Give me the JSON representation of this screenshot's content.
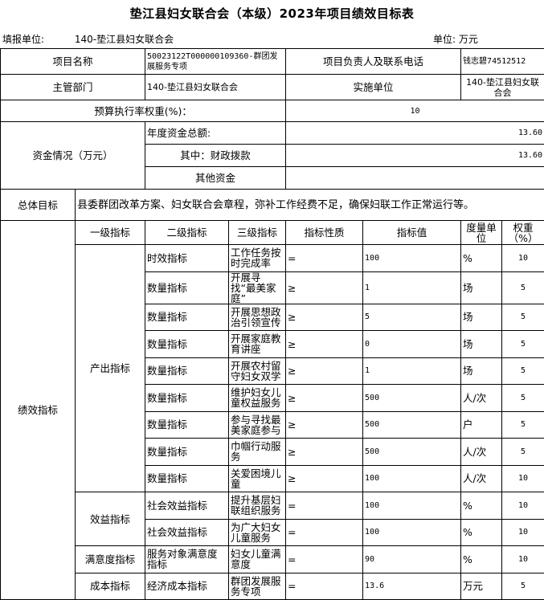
{
  "title": "垫江县妇女联合会（本级）2023年项目绩效目标表",
  "header": {
    "filler_label": "填报单位:",
    "filler_value": "140-垫江县妇女联合会",
    "unit_label": "单位:",
    "unit_value": "万元"
  },
  "info": {
    "project_name_label": "项目名称",
    "project_name_value": "50023122T000000109360-群团发展服务专项",
    "owner_label": "项目负责人及联系电话",
    "owner_value": "钱志碧74512512",
    "dept_label": "主管部门",
    "dept_value": "140-垫江县妇女联合会",
    "impl_label": "实施单位",
    "impl_value": "140-垫江县妇女联合会",
    "weight_label": "预算执行率权重(%)：",
    "weight_value": "10"
  },
  "funding": {
    "label": "资金情况（万元）",
    "total_label": "年度资金总额:",
    "total_value": "13.60",
    "fiscal_label": "其中：财政拨款",
    "fiscal_value": "13.60",
    "other_label": "其他资金",
    "other_value": ""
  },
  "goal": {
    "label": "总体目标",
    "text": "县委群团改革方案、妇女联合会章程，弥补工作经费不足，确保妇联工作正常运行等。"
  },
  "perf": {
    "label": "绩效指标",
    "headers": [
      "一级指标",
      "二级指标",
      "三级指标",
      "指标性质",
      "指标值",
      "度量单位",
      "权重（%）"
    ],
    "groups": [
      {
        "level1": "产出指标",
        "rows": [
          {
            "level2": "时效指标",
            "level3": "工作任务按时完成率",
            "nature": "=",
            "value": "100",
            "unit": "%",
            "weight": "10"
          },
          {
            "level2": "数量指标",
            "level3": "开展寻找“最美家庭”",
            "nature": "≥",
            "value": "1",
            "unit": "场",
            "weight": "5"
          },
          {
            "level2": "数量指标",
            "level3": "开展思想政治引领宣传",
            "nature": "≥",
            "value": "5",
            "unit": "场",
            "weight": "5"
          },
          {
            "level2": "数量指标",
            "level3": "开展家庭教育讲座",
            "nature": "≥",
            "value": "0",
            "unit": "场",
            "weight": "5"
          },
          {
            "level2": "数量指标",
            "level3": "开展农村留守妇女双学",
            "nature": "≥",
            "value": "1",
            "unit": "场",
            "weight": "5"
          },
          {
            "level2": "数量指标",
            "level3": "维护妇女儿童权益服务",
            "nature": "≥",
            "value": "500",
            "unit": "人/次",
            "weight": "5"
          },
          {
            "level2": "数量指标",
            "level3": "参与寻找最美家庭参与",
            "nature": "≥",
            "value": "500",
            "unit": "户",
            "weight": "5"
          },
          {
            "level2": "数量指标",
            "level3": "巾帼行动服务",
            "nature": "≥",
            "value": "500",
            "unit": "人/次",
            "weight": "5"
          },
          {
            "level2": "数量指标",
            "level3": "关爱困境儿童",
            "nature": "≥",
            "value": "100",
            "unit": "人/次",
            "weight": "10"
          }
        ]
      },
      {
        "level1": "效益指标",
        "rows": [
          {
            "level2": "社会效益指标",
            "level3": "提升基层妇联组织服务",
            "nature": "=",
            "value": "100",
            "unit": "%",
            "weight": "10"
          },
          {
            "level2": "社会效益指标",
            "level3": "为广大妇女儿童服务",
            "nature": "=",
            "value": "100",
            "unit": "%",
            "weight": "10"
          }
        ]
      },
      {
        "level1": "满意度指标",
        "rows": [
          {
            "level2": "服务对象满意度指标",
            "level3": "妇女儿童满意度",
            "nature": "=",
            "value": "90",
            "unit": "%",
            "weight": "10"
          }
        ]
      },
      {
        "level1": "成本指标",
        "rows": [
          {
            "level2": "经济成本指标",
            "level3": "群团发展服务专项",
            "nature": "=",
            "value": "13.6",
            "unit": "万元",
            "weight": "5"
          }
        ]
      }
    ]
  }
}
